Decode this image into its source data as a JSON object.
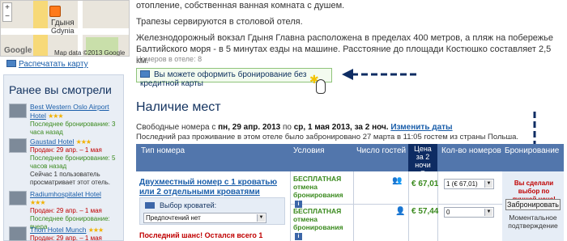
{
  "map": {
    "city_ru": "Гдыня",
    "city_en": "Gdynia",
    "zoom_plus": "+",
    "zoom_minus": "−",
    "google_logo": "Google",
    "map_data": "Map data ©2013 Google"
  },
  "print_map": "Распечатать карту",
  "recent": {
    "title": "Ранее вы смотрели",
    "items": [
      {
        "name": "Best Western Oslo Airport Hotel",
        "stars": "★★★",
        "line1": "Последнее бронирование: 3 часа назад"
      },
      {
        "name": "Gaustad Hotel",
        "stars": "★★★",
        "line1": "Продан: 29 апр. – 1 мая",
        "line2": "Последнее бронирование: 5 часов назад",
        "line3": "Сейчас 1 пользователь просматривает этот отель."
      },
      {
        "name": "Radiumhospitalet Hotel",
        "stars": "★★★",
        "line1": "Продан: 29 апр. – 1 мая",
        "line2": "Последнее бронирование: вчера"
      },
      {
        "name": "Thon Hotel Munch",
        "stars": "★★★",
        "line1": "Продан: 29 апр. – 1 мая"
      }
    ]
  },
  "description": {
    "line1": "отопление, собственная ванная комната с душем.",
    "line2": "Трапезы сервируются в столовой отеля.",
    "line3": "Железнодорожный вокзал Гдыня Главна расположена в пределах 400 метров, а пляж на побережье Балтийского моря - в 5 минутах езды на машине. Расстояние до площади Костюшко составляет 2,5 км."
  },
  "rooms_count": "Номеров в отеле: 8",
  "no_credit_card": "Вы можете оформить бронирование без кредитной карты",
  "availability": {
    "title": "Наличие мест",
    "free_rooms_prefix": "Свободные номера с ",
    "date_from": "пн, 29 апр. 2013",
    "to_word": " по ",
    "date_to": "ср, 1 мая 2013",
    "nights": ", за 2 ноч.",
    "change_dates": "Изменить даты",
    "last_booking": "Последний раз проживание в этом отеле было забронировано 27 марта в 11:05 гостем из страны Польша."
  },
  "table": {
    "headers": {
      "room_type": "Тип номера",
      "conditions": "Условия",
      "guests": "Число гостей",
      "price_line1": "Цена",
      "price_line2": "за 2",
      "price_line3": "ночи",
      "quantity": "Кол-во номеров",
      "booking": "Бронирование"
    },
    "room_name": "Двухместный номер с 1 кроватью или 2 отдельными кроватями",
    "bed_choice_label": "Выбор кроватей:",
    "bed_choice_value": "Предпочтений нет",
    "last_chance": "Последний шанс! Остался всего 1",
    "rows": [
      {
        "condition": "БЕСПЛАТНАЯ отмена бронирования",
        "price": "€ 67,01",
        "quantity": "1 (€ 67,01)"
      },
      {
        "condition": "БЕСПЛАТНАЯ отмена бронирования",
        "price": "€ 57,44",
        "quantity": "0"
      }
    ],
    "best_choice": "Вы сделали выбор по лучшей цене!",
    "book_button": "Забронировать",
    "instant_confirmation": "Моментальное подтверждение"
  }
}
